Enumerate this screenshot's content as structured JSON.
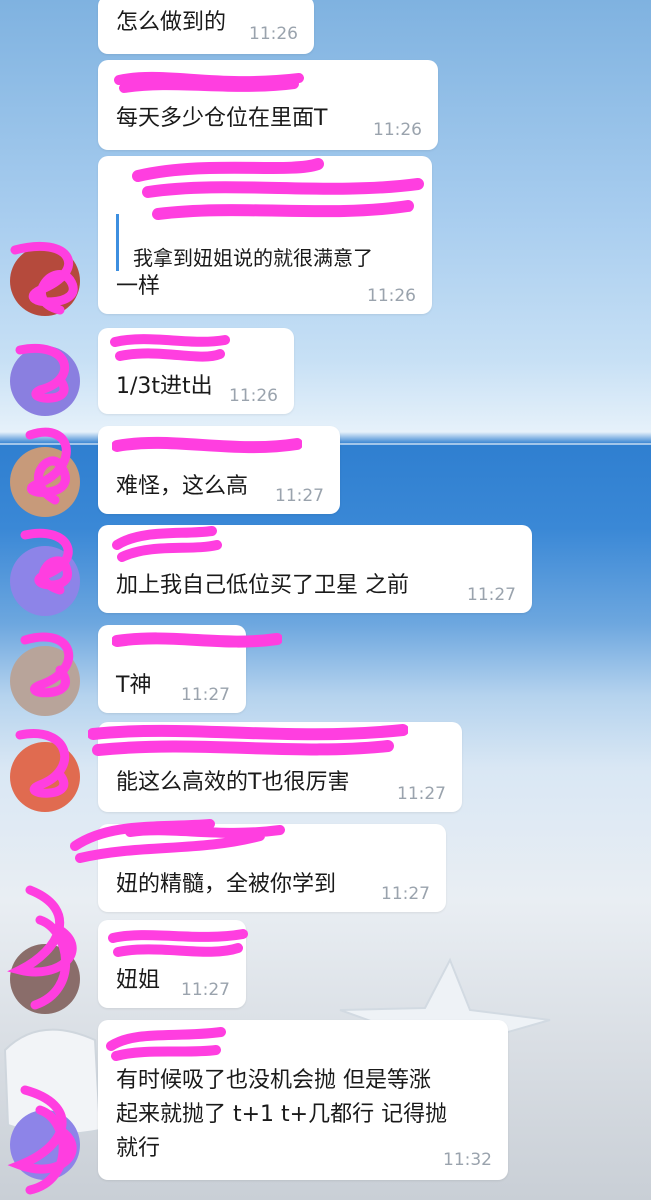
{
  "colors": {
    "bubble": "#ffffff",
    "timestamp": "#9aa3ad",
    "quote_bar": "#3d8fe0",
    "redaction": "#ff3ee0"
  },
  "messages": [
    {
      "text": "怎么做到的",
      "time": "11:26"
    },
    {
      "text": "每天多少仓位在里面T",
      "time": "11:26"
    },
    {
      "quote": "我拿到妞姐说的就很满意了",
      "text": "一样",
      "time": "11:26"
    },
    {
      "text": "1/3t进t出",
      "time": "11:26"
    },
    {
      "text": "难怪，这么高",
      "time": "11:27"
    },
    {
      "text": "加上我自己低位买了卫星 之前",
      "time": "11:27"
    },
    {
      "text": "T神",
      "time": "11:27"
    },
    {
      "text": "能这么高效的T也很厉害",
      "time": "11:27"
    },
    {
      "text": "妞的精髓，全被你学到",
      "time": "11:27"
    },
    {
      "text": "妞姐",
      "time": "11:27"
    },
    {
      "text": "有时候吸了也没机会抛 但是等涨\n起来就抛了 t+1 t+几都行 记得抛\n就行",
      "time": "11:32"
    }
  ]
}
